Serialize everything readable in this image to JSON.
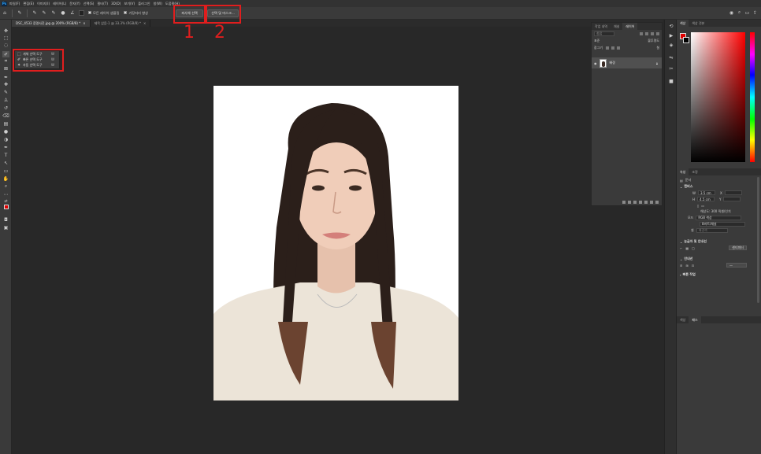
{
  "menubar": {
    "logo": "Ps",
    "items": [
      "파일(F)",
      "편집(E)",
      "이미지(I)",
      "레이어(L)",
      "문자(Y)",
      "선택(S)",
      "필터(T)",
      "3D(D)",
      "보기(V)",
      "플러그인",
      "창(W)",
      "도움말(H)"
    ]
  },
  "options": {
    "sample_all_label": "모든 레이어 샘플링",
    "enhance_edge_label": "가장자리 향상",
    "select_subject_label": "피사체 선택",
    "select_mask_label": "선택 및 마스크..."
  },
  "tabs": [
    {
      "label": "DSC_4533 증명사진.jpg @ 200% (RGB/8) *"
    },
    {
      "label": "제목 없음-1 @ 33.3% (RGB/8) *"
    }
  ],
  "flyout": {
    "items": [
      {
        "label": "개체 선택 도구",
        "key": "W"
      },
      {
        "label": "빠른 선택 도구",
        "key": "W"
      },
      {
        "label": "자동 선택 도구",
        "key": "W"
      }
    ]
  },
  "annotations": {
    "one": "1",
    "two": "2"
  },
  "layers_panel": {
    "tabs": [
      "작업 내역",
      "채널",
      "레이어"
    ],
    "search_placeholder": "종류",
    "blend_mode": "표준",
    "opacity_label": "불투명도",
    "lock_label": "잠그기",
    "fill_label": "칠",
    "layer_name": "배경"
  },
  "color_panel": {
    "tabs": [
      "색상",
      "색상 견본"
    ],
    "foreground": "#e00000",
    "background": "#000000"
  },
  "properties": {
    "tabs": [
      "속성",
      "조정"
    ],
    "doc_label": "문서",
    "canvas_heading": "캔버스",
    "w_label": "W",
    "w_value": "3.5 cm",
    "h_label": "H",
    "h_value": "4.5 cm",
    "x_label": "X",
    "y_label": "Y",
    "resolution": "해상도: 300 픽셀/인치",
    "mode_label": "모드",
    "mode_value": "RGB 색상",
    "depth_value": "8비트/채널",
    "fill_label": "칠",
    "fill_value": "배경색",
    "rulers_heading": "눈금자 및 안내선",
    "unit_value": "센티미터",
    "guides_heading": "안내선",
    "quick_actions": "빠른 작업"
  },
  "bottom_tabs": [
    "색상",
    "패스"
  ],
  "colors": {
    "annotation": "#e01e1e",
    "canvas_bg": "#282828",
    "panel_bg": "#3a3a3a"
  }
}
